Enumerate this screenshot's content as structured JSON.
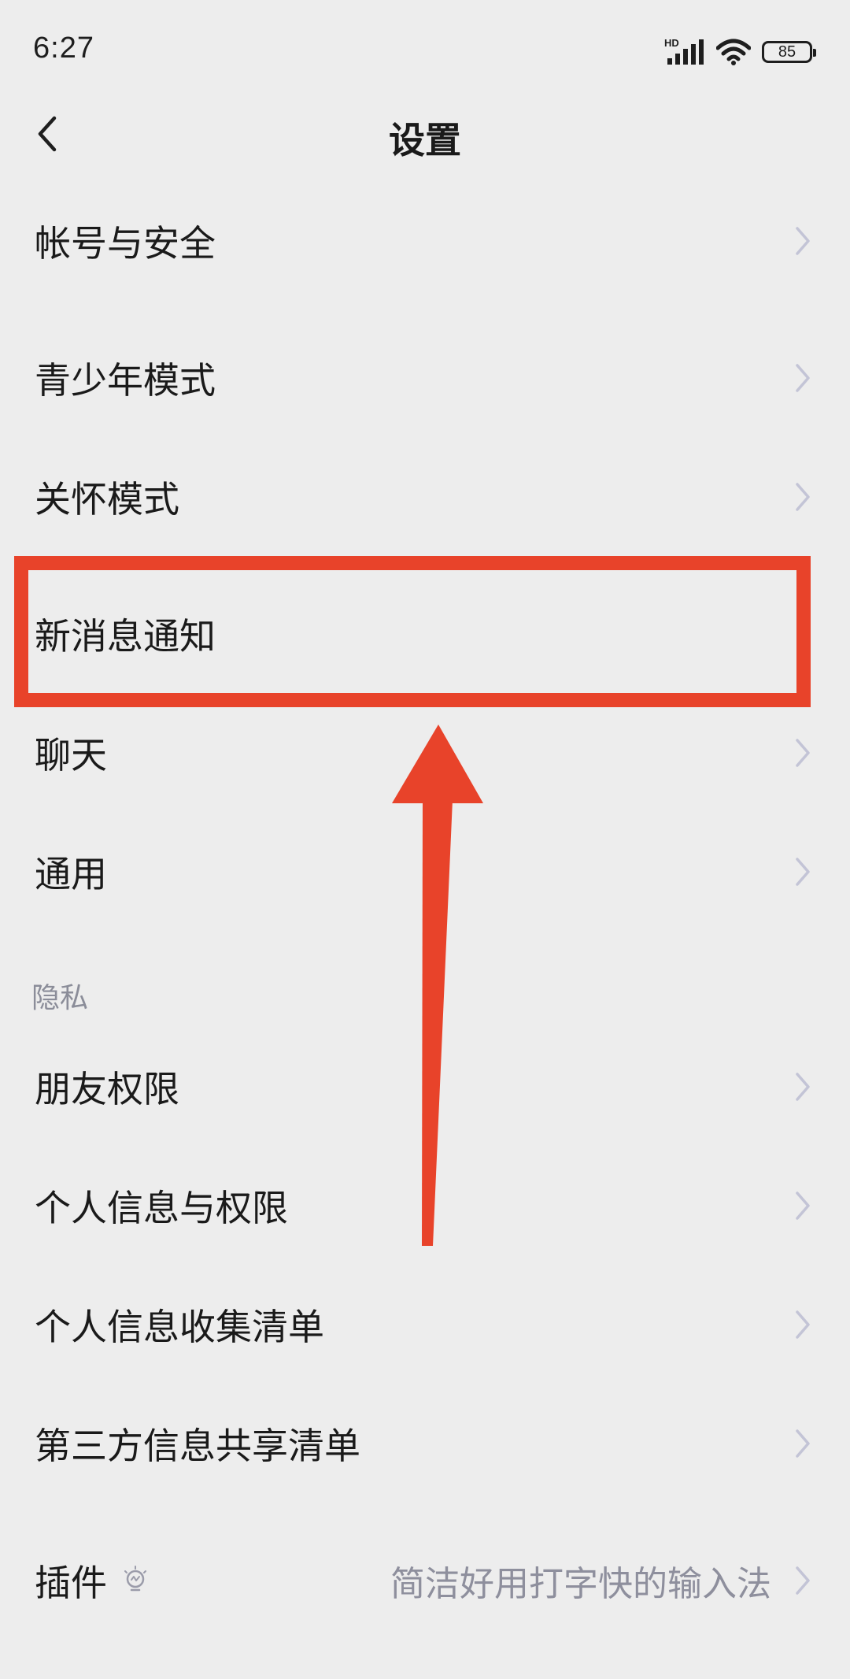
{
  "status": {
    "time": "6:27",
    "network_label": "HD",
    "battery": "85"
  },
  "header": {
    "title": "设置"
  },
  "items": [
    {
      "label": "帐号与安全"
    },
    {
      "label": "青少年模式"
    },
    {
      "label": "关怀模式"
    },
    {
      "label": "新消息通知"
    },
    {
      "label": "聊天"
    },
    {
      "label": "通用"
    }
  ],
  "privacy_section": {
    "title": "隐私",
    "items": [
      {
        "label": "朋友权限"
      },
      {
        "label": "个人信息与权限"
      },
      {
        "label": "个人信息收集清单"
      },
      {
        "label": "第三方信息共享清单"
      }
    ]
  },
  "plugin": {
    "label": "插件",
    "subtitle": "简洁好用打字快的输入法"
  },
  "colors": {
    "annotation": "#e8432a",
    "chevron": "#c3c4d6",
    "secondary_text": "#8e8f9d"
  },
  "icons": {
    "back": "chevron-left-icon",
    "item": "chevron-right-icon",
    "plugin_hint": "lightbulb-icon",
    "signal": "signal-icon",
    "wifi": "wifi-icon",
    "battery": "battery-icon"
  }
}
